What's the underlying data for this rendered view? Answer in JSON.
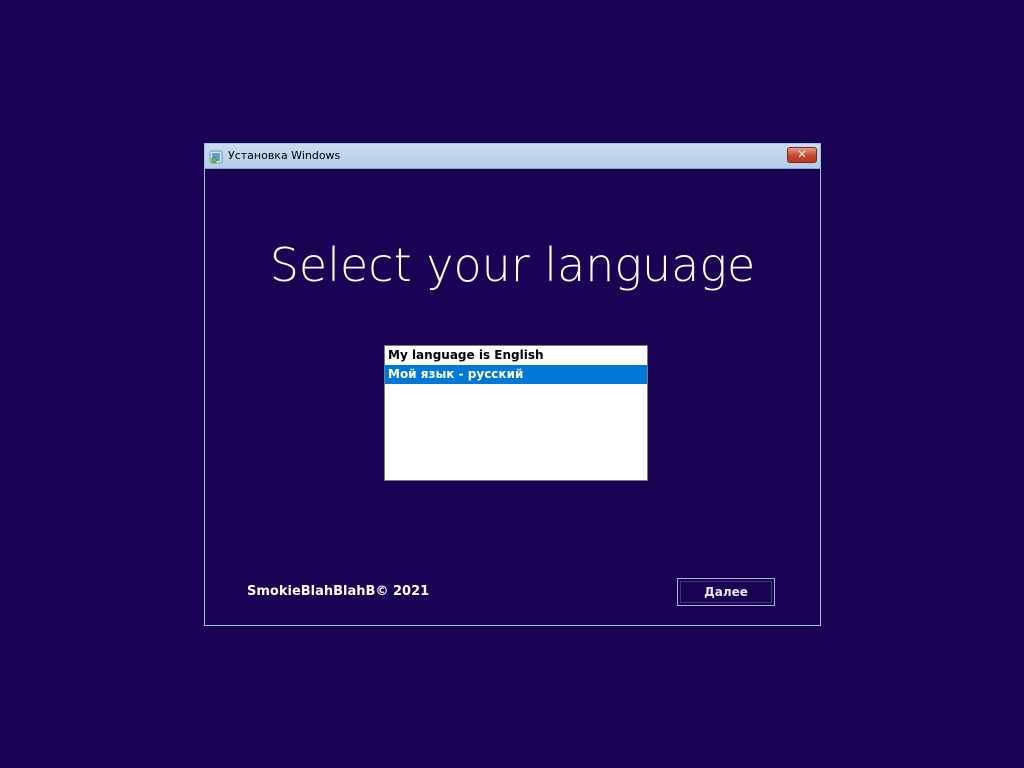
{
  "window": {
    "title": "Установка Windows",
    "close_label": "✕"
  },
  "main": {
    "headline": "Select your language"
  },
  "language_list": {
    "items": [
      {
        "label": "My language is English",
        "selected": false
      },
      {
        "label": "Мой язык - русский",
        "selected": true
      }
    ]
  },
  "footer": {
    "copyright": "SmokieBlahBlahB© 2021",
    "next_label": "Далее"
  },
  "colors": {
    "background": "#190153",
    "selection": "#0078d7"
  }
}
